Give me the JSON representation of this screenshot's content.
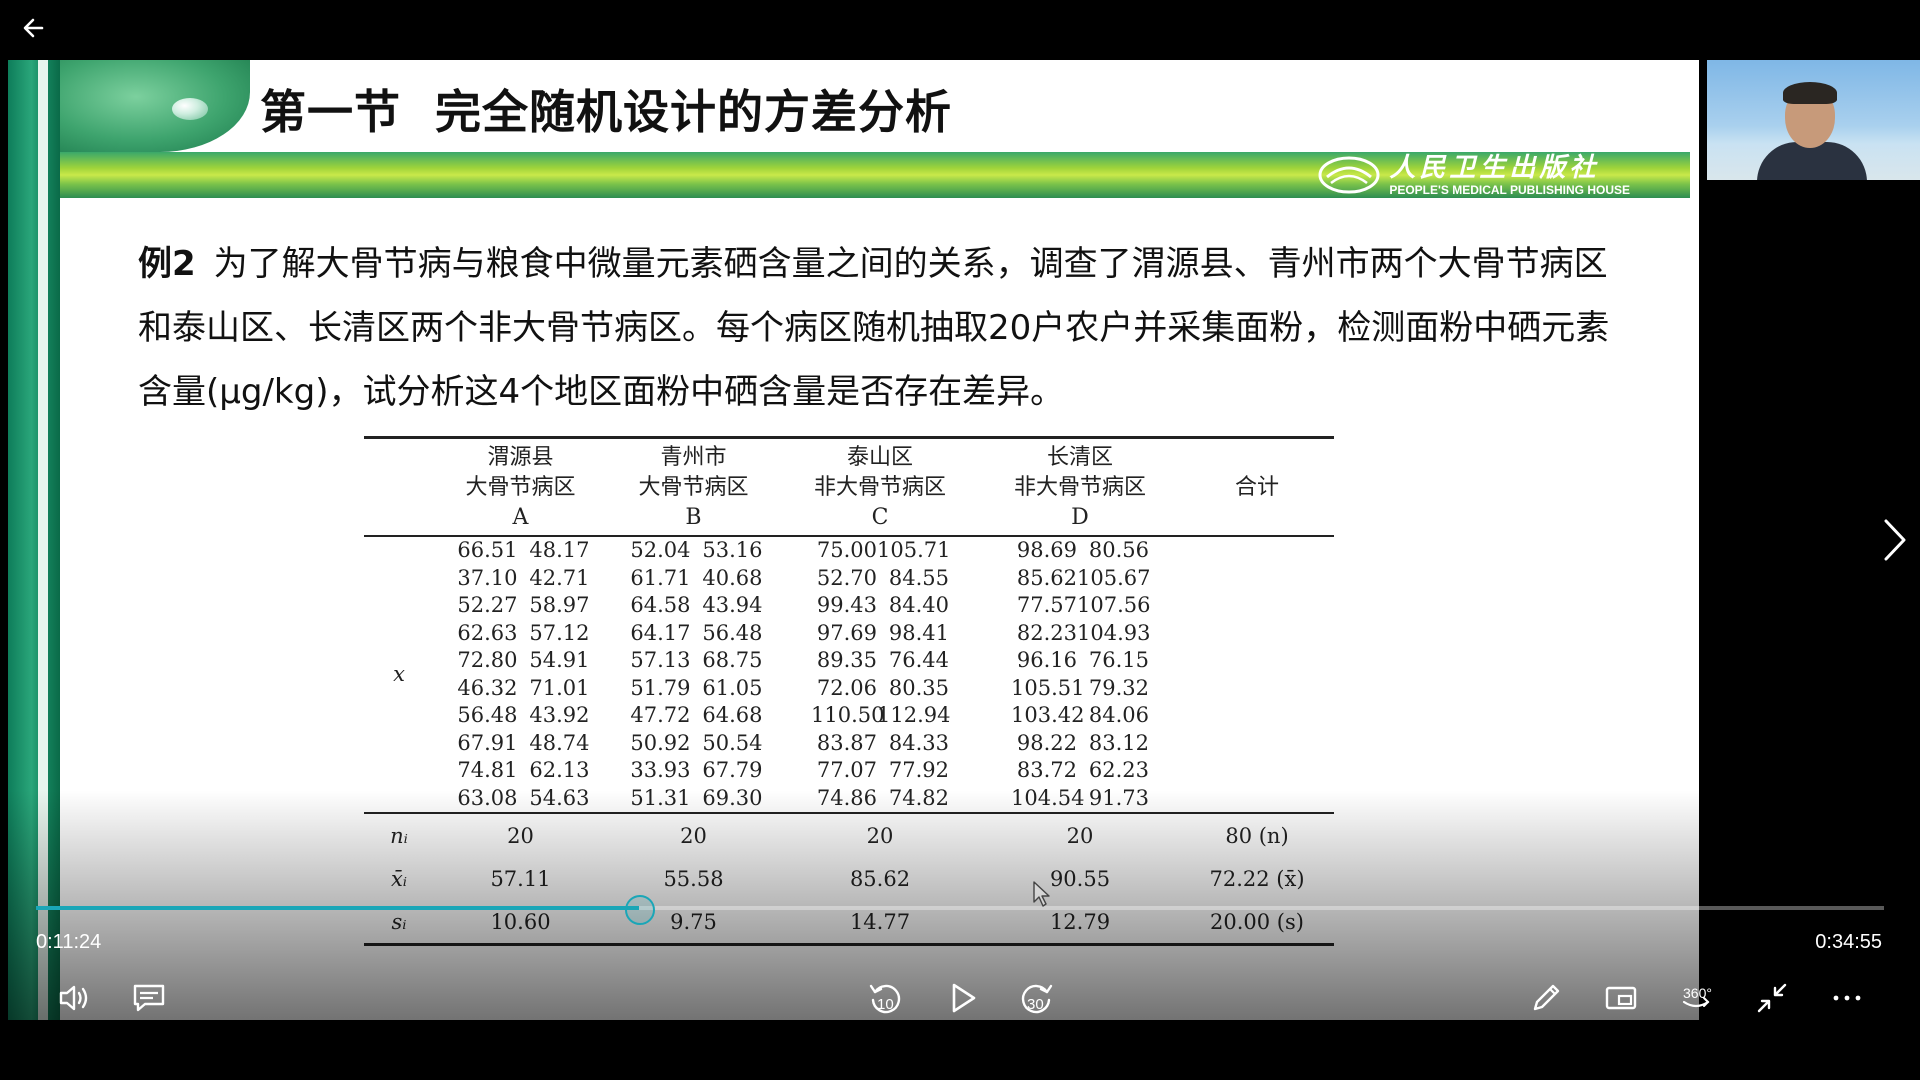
{
  "slide": {
    "title": "第一节  完全随机设计的方差分析",
    "publisher_cn": "人民卫生出版社",
    "publisher_en": "PEOPLE'S MEDICAL PUBLISHING HOUSE",
    "problem_label": "例2",
    "problem_text": "为了解大骨节病与粮食中微量元素硒含量之间的关系，调查了渭源县、青州市两个大骨节病区和泰山区、长清区两个非大骨节病区。每个病区随机抽取20户农户并采集面粉，检测面粉中硒元素含量(μg/kg)，试分析这4个地区面粉中硒含量是否存在差异。",
    "table": {
      "headers": [
        {
          "l1": "渭源县",
          "l2": "大骨节病区",
          "l3": "A"
        },
        {
          "l1": "青州市",
          "l2": "大骨节病区",
          "l3": "B"
        },
        {
          "l1": "泰山区",
          "l2": "非大骨节病区",
          "l3": "C"
        },
        {
          "l1": "长清区",
          "l2": "非大骨节病区",
          "l3": "D"
        }
      ],
      "total_header": "合计",
      "x_label": "x",
      "rows": [
        [
          "66.51",
          "48.17",
          "52.04",
          "53.16",
          "75.00",
          "105.71",
          "98.69",
          "80.56"
        ],
        [
          "37.10",
          "42.71",
          "61.71",
          "40.68",
          "52.70",
          "84.55",
          "85.62",
          "105.67"
        ],
        [
          "52.27",
          "58.97",
          "64.58",
          "43.94",
          "99.43",
          "84.40",
          "77.57",
          "107.56"
        ],
        [
          "62.63",
          "57.12",
          "64.17",
          "56.48",
          "97.69",
          "98.41",
          "82.23",
          "104.93"
        ],
        [
          "72.80",
          "54.91",
          "57.13",
          "68.75",
          "89.35",
          "76.44",
          "96.16",
          "76.15"
        ],
        [
          "46.32",
          "71.01",
          "51.79",
          "61.05",
          "72.06",
          "80.35",
          "105.51",
          "79.32"
        ],
        [
          "56.48",
          "43.92",
          "47.72",
          "64.68",
          "110.50",
          "112.94",
          "103.42",
          "84.06"
        ],
        [
          "67.91",
          "48.74",
          "50.92",
          "50.54",
          "83.87",
          "84.33",
          "98.22",
          "83.12"
        ],
        [
          "74.81",
          "62.13",
          "33.93",
          "67.79",
          "77.07",
          "77.92",
          "83.72",
          "62.23"
        ],
        [
          "63.08",
          "54.63",
          "51.31",
          "69.30",
          "74.86",
          "74.82",
          "104.54",
          "91.73"
        ]
      ],
      "stats": [
        {
          "symbol": "nᵢ",
          "values": [
            "20",
            "20",
            "20",
            "20"
          ],
          "total": "80 (n)"
        },
        {
          "symbol": "x̄ᵢ",
          "values": [
            "57.11",
            "55.58",
            "85.62",
            "90.55"
          ],
          "total": "72.22 (x̄)"
        },
        {
          "symbol": "sᵢ",
          "values": [
            "10.60",
            "9.75",
            "14.77",
            "12.79"
          ],
          "total": "20.00 (s)"
        }
      ]
    }
  },
  "player": {
    "current_time": "0:11:24",
    "total_time": "0:34:55",
    "progress": 0.3265,
    "rewind_label": "10",
    "forward_label": "30",
    "vr_label": "360°",
    "accent": "#1aa6b7"
  }
}
